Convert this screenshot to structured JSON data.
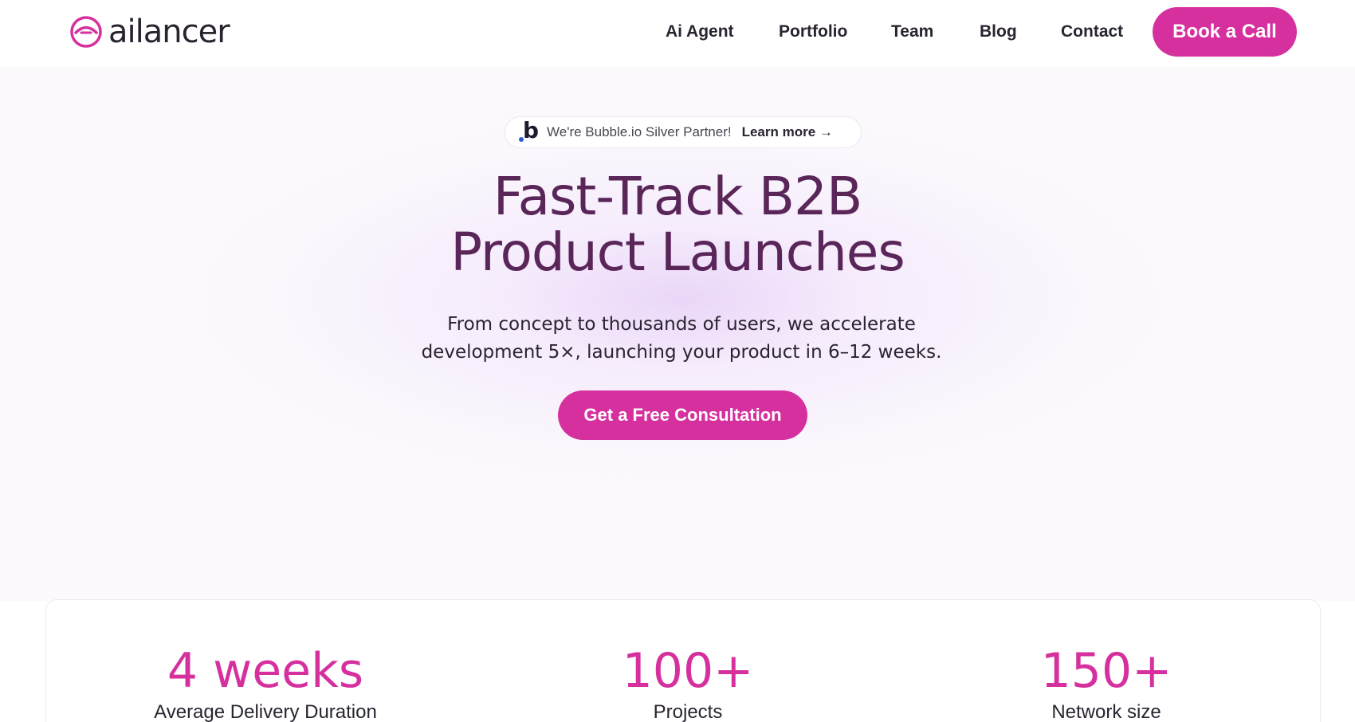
{
  "header": {
    "logo_text": "ailancer",
    "logo_icon": "ailancer-logo-icon",
    "nav": [
      {
        "label": "Ai Agent"
      },
      {
        "label": "Portfolio"
      },
      {
        "label": "Team"
      },
      {
        "label": "Blog"
      },
      {
        "label": "Contact"
      }
    ],
    "cta_label": "Book a Call"
  },
  "hero": {
    "badge": {
      "icon": "bubble-logo-icon",
      "text": "We're Bubble.io Silver Partner!",
      "link_label": "Learn more →"
    },
    "title_line1": "Fast-Track B2B",
    "title_line2": "Product Launches",
    "subtitle_line1": "From concept to thousands of users, we accelerate",
    "subtitle_line2": "development 5×, launching your product in 6–12 weeks.",
    "cta_label": "Get a Free Consultation"
  },
  "stats": [
    {
      "value": "4 weeks",
      "label": "Average Delivery Duration"
    },
    {
      "value": "100+",
      "label": "Projects"
    },
    {
      "value": "150+",
      "label": "Network size"
    }
  ],
  "colors": {
    "accent": "#d6309f",
    "heading": "#5a2558",
    "text": "#2a2330"
  }
}
